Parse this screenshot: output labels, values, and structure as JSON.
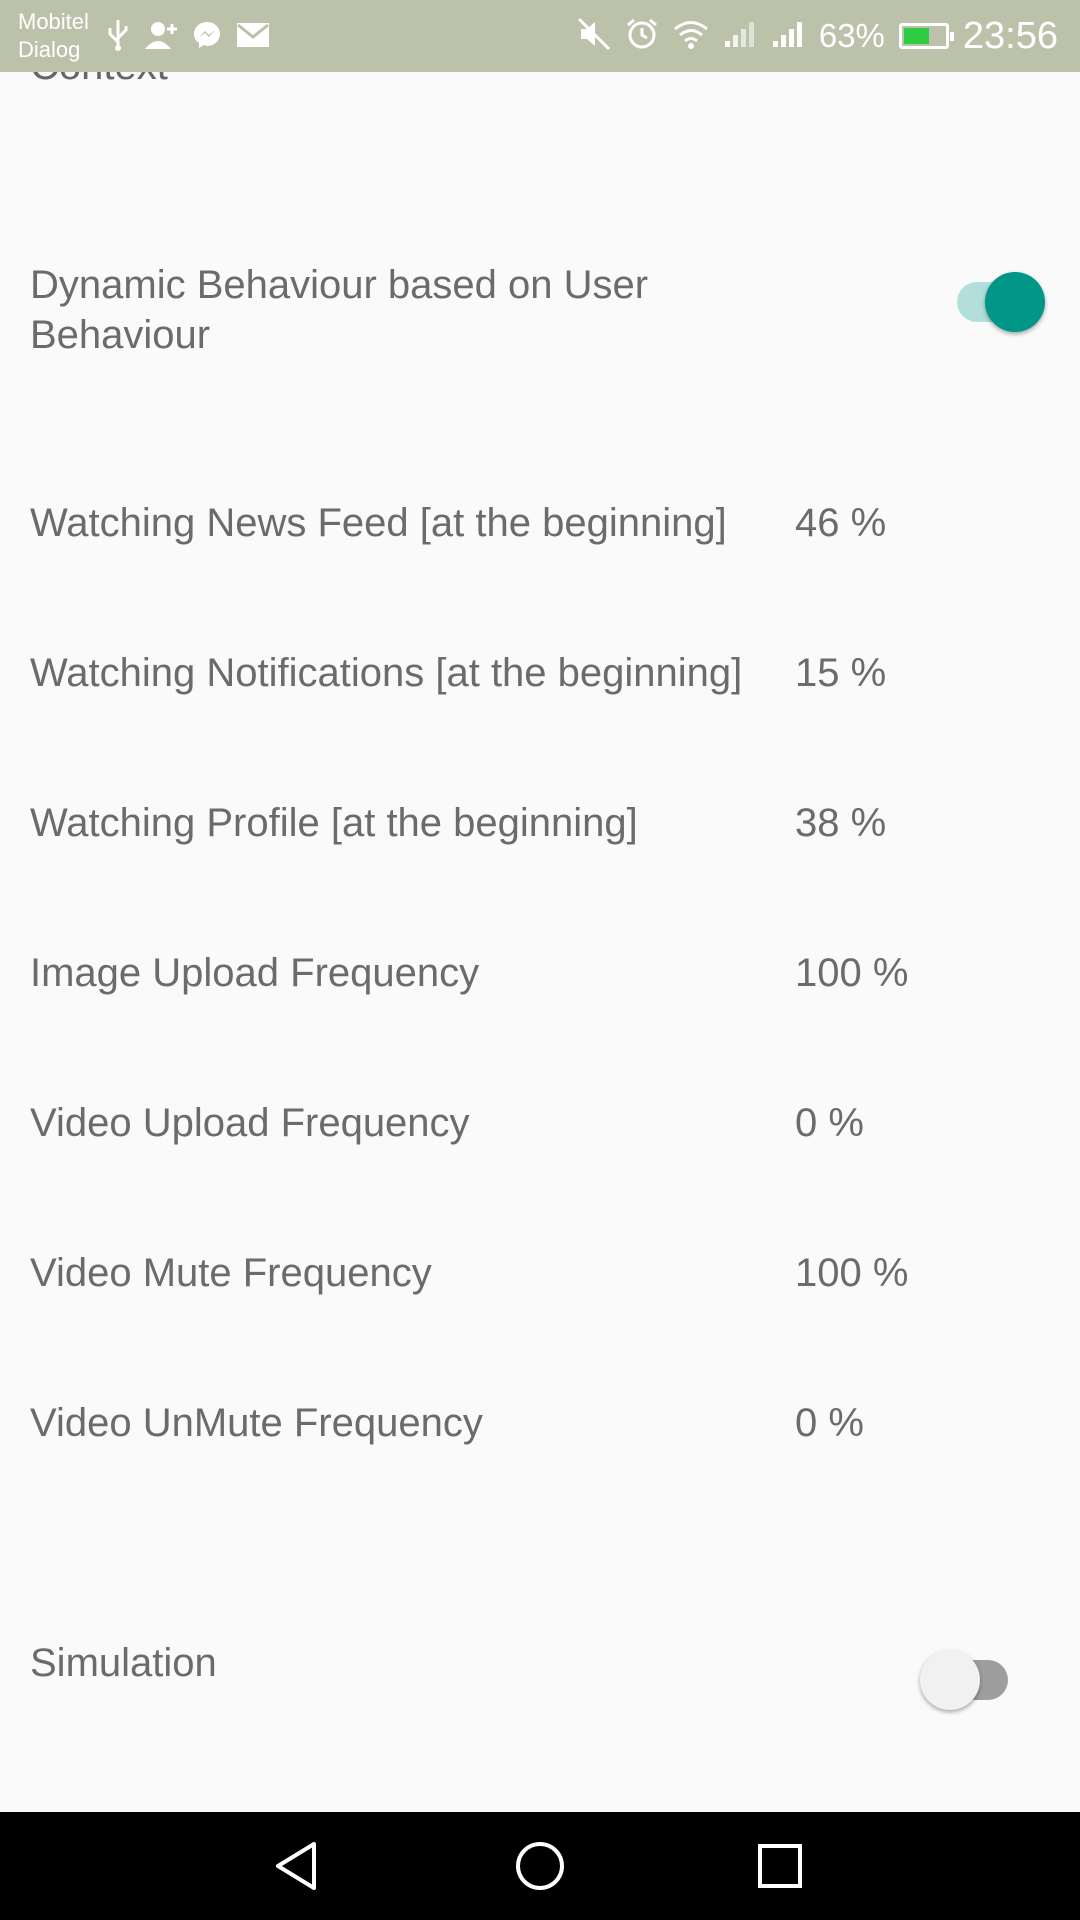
{
  "status_bar": {
    "carrier_line1": "Mobitel",
    "carrier_line2": "Dialog",
    "battery_percent": "63%",
    "battery_level": 0.63,
    "time": "23:56",
    "icons": [
      "usb-icon",
      "add-contact-icon",
      "messenger-icon",
      "mail-icon",
      "mute-icon",
      "alarm-icon",
      "wifi-icon",
      "signal-icon",
      "signal-icon",
      "battery-charging-icon"
    ],
    "background_color": "#bcc2aa"
  },
  "section": {
    "partial_title": "Context"
  },
  "settings": {
    "dynamic_behaviour": {
      "label": "Dynamic Behaviour based on User Behaviour",
      "enabled": true
    },
    "rows": [
      {
        "label": "Watching News Feed [at the beginning]",
        "value": "46 %"
      },
      {
        "label": "Watching Notifications [at the beginning]",
        "value": "15 %"
      },
      {
        "label": "Watching Profile [at the beginning]",
        "value": "38 %"
      },
      {
        "label": "Image Upload Frequency",
        "value": "100 %"
      },
      {
        "label": "Video Upload Frequency",
        "value": "0 %"
      },
      {
        "label": "Video Mute Frequency",
        "value": "100 %"
      },
      {
        "label": "Video UnMute Frequency",
        "value": "0 %"
      }
    ],
    "simulation": {
      "label": "Simulation",
      "enabled": false
    }
  },
  "colors": {
    "accent": "#009688",
    "accent_track": "#b2dfdb",
    "text": "#6b6b6b",
    "background": "#fafafa"
  },
  "nav_bar": {
    "buttons": [
      "back-icon",
      "home-icon",
      "recents-icon"
    ]
  }
}
